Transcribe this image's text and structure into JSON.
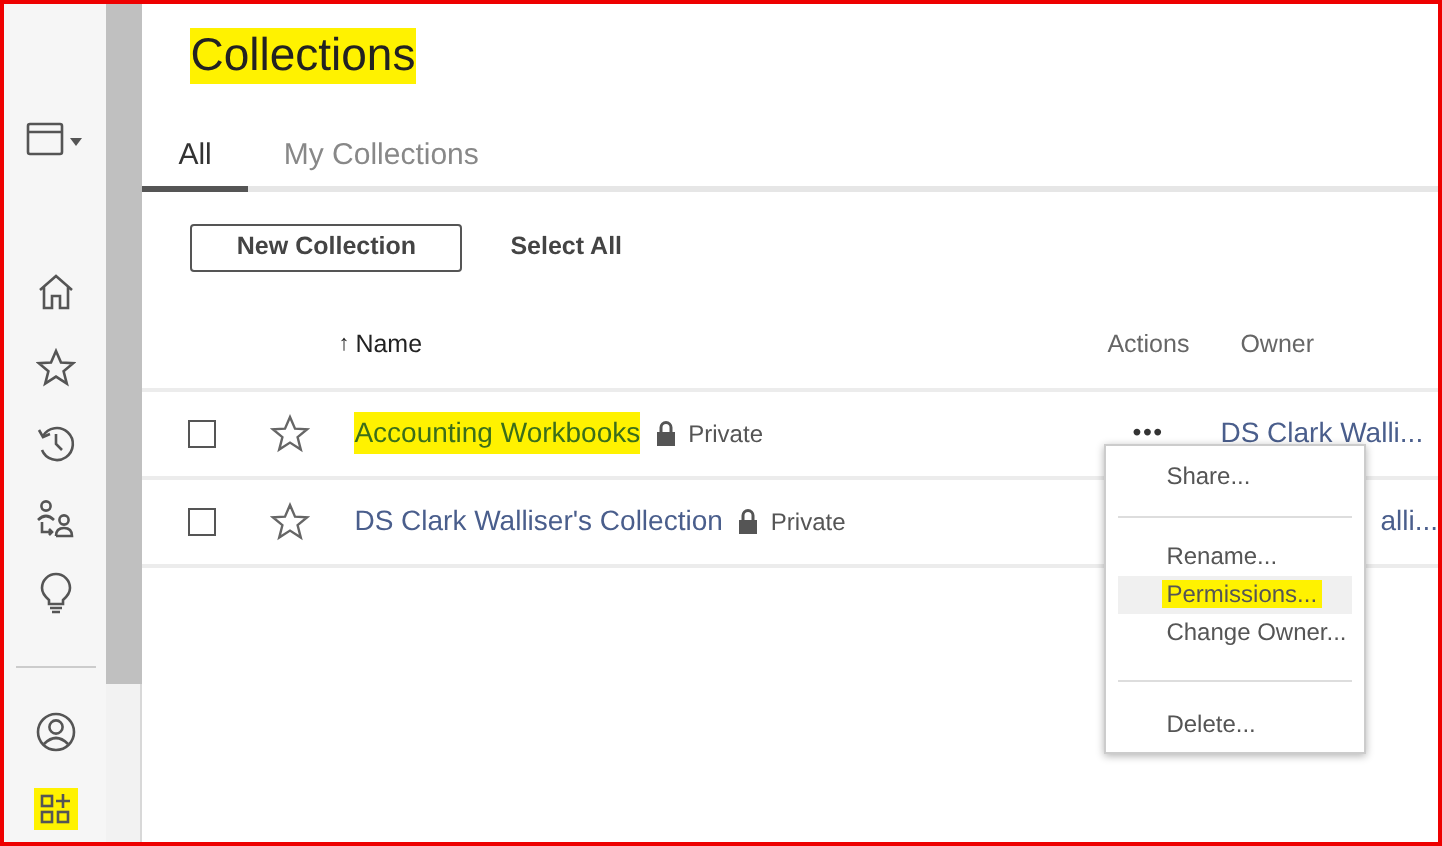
{
  "sidebar": {
    "items": [
      {
        "highlighted": false
      },
      {
        "highlighted": false
      },
      {
        "highlighted": false
      },
      {
        "highlighted": false
      },
      {
        "highlighted": false
      },
      {
        "highlighted": false
      },
      {
        "highlighted": false
      },
      {
        "highlighted": true
      }
    ]
  },
  "title": {
    "text": "Collections",
    "highlighted": true
  },
  "tabs": [
    {
      "label": "All",
      "selected": true
    },
    {
      "label": "My Collections",
      "selected": false
    }
  ],
  "toolbar": {
    "new_button": "New Collection",
    "select_all": "Select All"
  },
  "table": {
    "columns": [
      {
        "label": "Name",
        "sort_arrow": "↑"
      },
      {
        "label": "Actions"
      },
      {
        "label": "Owner"
      }
    ],
    "rows": [
      {
        "checked": false,
        "starred": false,
        "name": "Accounting Workbooks",
        "highlighted": true,
        "privacy": "Private",
        "actions": "•••",
        "owner": "DS Clark Walli..."
      },
      {
        "checked": false,
        "starred": false,
        "name": "DS Clark Walliser's Collection",
        "highlighted": false,
        "privacy": "Private",
        "owner": "alli..."
      }
    ]
  },
  "menu": {
    "groups": [
      [
        {
          "label": "Share...",
          "hovered": false,
          "highlighted": false
        }
      ],
      [
        {
          "label": "Rename...",
          "hovered": false,
          "highlighted": false
        },
        {
          "label": "Permissions...",
          "hovered": true,
          "highlighted": true
        },
        {
          "label": "Change Owner...",
          "hovered": false,
          "highlighted": false
        }
      ],
      [
        {
          "label": "Delete...",
          "hovered": false,
          "highlighted": false
        }
      ]
    ]
  }
}
